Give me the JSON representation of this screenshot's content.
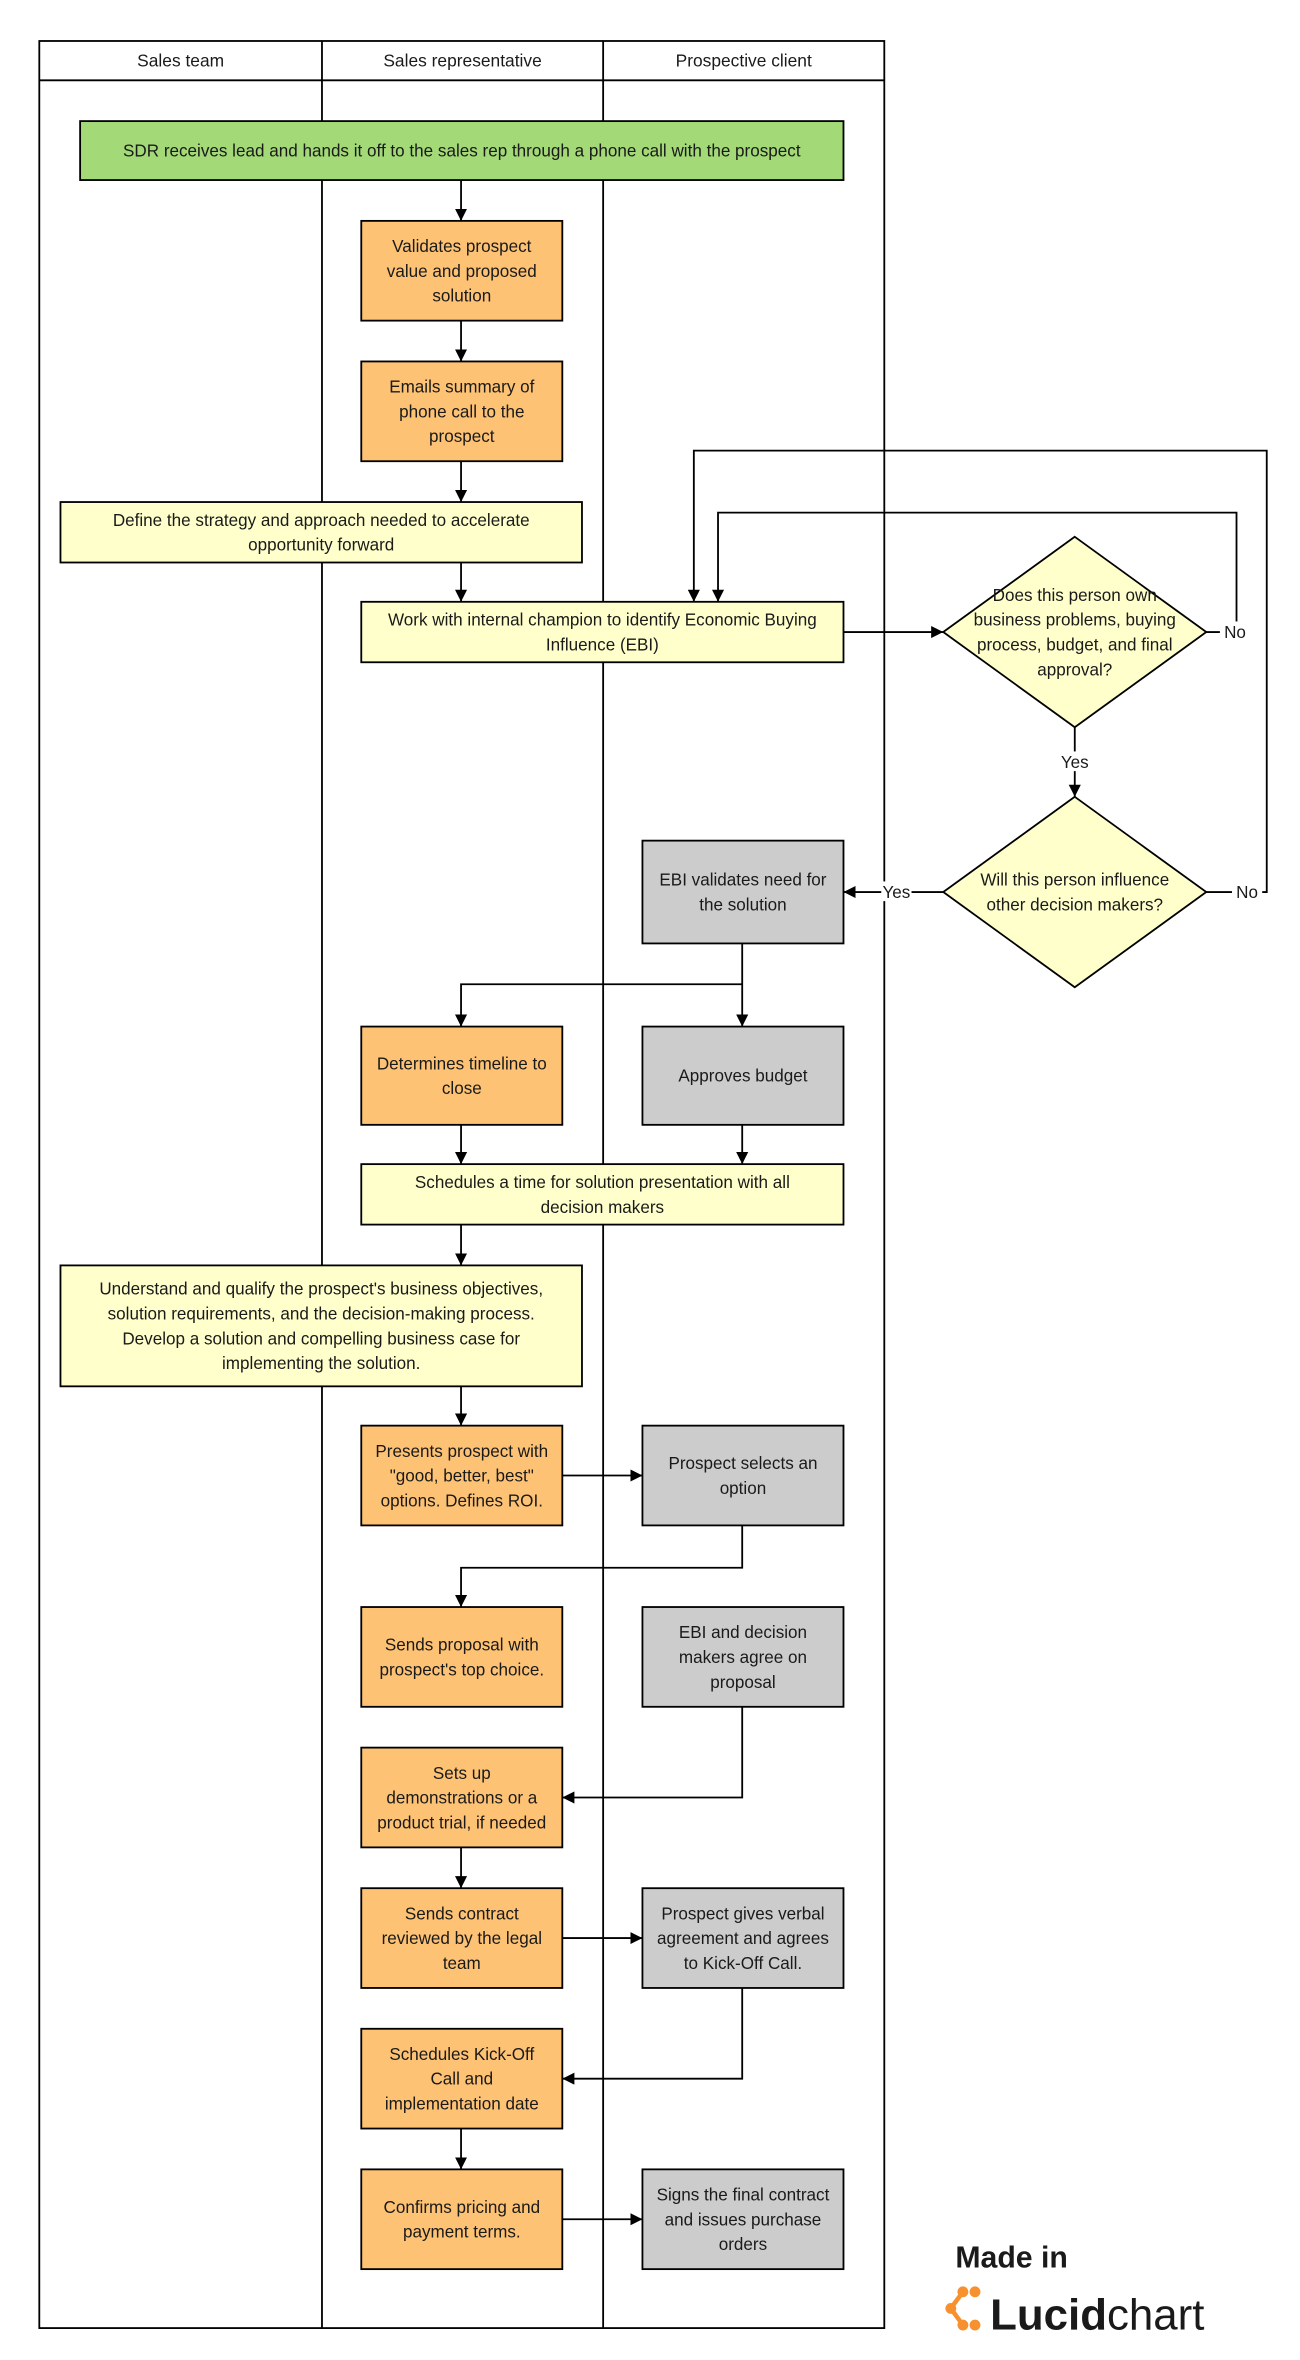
{
  "lanes": [
    "Sales team",
    "Sales representative",
    "Prospective client"
  ],
  "colors": {
    "green": "#a3d977",
    "orange": "#fdc274",
    "yellow": "#ffffcc",
    "gray": "#cccccc",
    "line": "#000000"
  },
  "nodes": {
    "n1": {
      "color": "green",
      "lines": [
        "SDR receives lead and hands it off to the sales rep through a phone call with the prospect"
      ]
    },
    "n2": {
      "color": "orange",
      "lines": [
        "Validates prospect",
        "value and proposed",
        "solution"
      ]
    },
    "n3": {
      "color": "orange",
      "lines": [
        "Emails summary of",
        "phone call to the",
        "prospect"
      ]
    },
    "n4": {
      "color": "yellow",
      "lines": [
        "Define the strategy and approach needed to accelerate",
        "opportunity forward"
      ]
    },
    "n5": {
      "color": "yellow",
      "lines": [
        "Work with internal champion to identify Economic Buying",
        "Influence (EBI)"
      ]
    },
    "d1": {
      "color": "yellow",
      "lines": [
        "Does this person own",
        "business problems, buying",
        "process, budget, and final",
        "approval?"
      ]
    },
    "d2": {
      "color": "yellow",
      "lines": [
        "Will this person influence",
        "other decision makers?"
      ]
    },
    "n6": {
      "color": "gray",
      "lines": [
        "EBI validates need for",
        "the solution"
      ]
    },
    "n7": {
      "color": "orange",
      "lines": [
        "Determines timeline to",
        "close"
      ]
    },
    "n8": {
      "color": "gray",
      "lines": [
        "Approves budget"
      ]
    },
    "n9": {
      "color": "yellow",
      "lines": [
        "Schedules a time for solution presentation with all",
        "decision makers"
      ]
    },
    "n10": {
      "color": "yellow",
      "lines": [
        "Understand and qualify the prospect's business objectives,",
        "solution requirements, and the decision-making process.",
        "Develop a solution and compelling business case for",
        "implementing the solution."
      ]
    },
    "n11": {
      "color": "orange",
      "lines": [
        "Presents prospect with",
        "\"good, better, best\"",
        "options. Defines ROI."
      ]
    },
    "n12": {
      "color": "gray",
      "lines": [
        "Prospect selects an",
        "option"
      ]
    },
    "n13": {
      "color": "orange",
      "lines": [
        "Sends proposal with",
        "prospect's top choice."
      ]
    },
    "n14": {
      "color": "gray",
      "lines": [
        "EBI and decision",
        "makers agree on",
        "proposal"
      ]
    },
    "n15": {
      "color": "orange",
      "lines": [
        "Sets up",
        "demonstrations or a",
        "product trial, if needed"
      ]
    },
    "n16": {
      "color": "orange",
      "lines": [
        "Sends contract",
        "reviewed by the legal",
        "team"
      ]
    },
    "n17": {
      "color": "gray",
      "lines": [
        "Prospect gives verbal",
        "agreement and agrees",
        "to Kick-Off Call."
      ]
    },
    "n18": {
      "color": "orange",
      "lines": [
        "Schedules Kick-Off",
        "Call and",
        "implementation date"
      ]
    },
    "n19": {
      "color": "orange",
      "lines": [
        "Confirms pricing and",
        "payment terms."
      ]
    },
    "n20": {
      "color": "gray",
      "lines": [
        "Signs the final contract",
        "and issues purchase",
        "orders"
      ]
    }
  },
  "edge_labels": {
    "d1_no": "No",
    "d2_no": "No",
    "d1_yes": "Yes",
    "d2_yes": "Yes"
  },
  "logo": {
    "made_in": "Made in",
    "brand_bold": "Lucid",
    "brand_light": "chart",
    "icon_color": "#f7912f",
    "text_color": "#3d4752"
  }
}
